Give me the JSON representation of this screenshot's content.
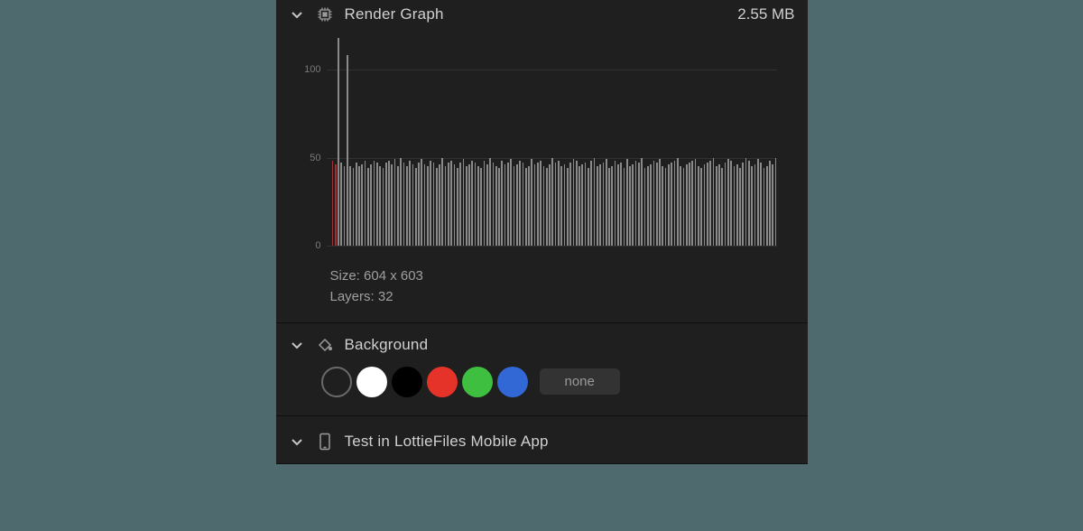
{
  "render_graph": {
    "title": "Render Graph",
    "file_size": "2.55 MB",
    "size_label": "Size: 604 x 603",
    "layers_label": "Layers: 32"
  },
  "background": {
    "title": "Background",
    "none_label": "none",
    "swatches": [
      "transparent",
      "#ffffff",
      "#000000",
      "#e6332a",
      "#3fbf3f",
      "#3268d6"
    ]
  },
  "test_section": {
    "title": "Test in LottieFiles Mobile App"
  },
  "chart_data": {
    "type": "bar",
    "title": "Render Graph",
    "xlabel": "",
    "ylabel": "",
    "ylim": [
      0,
      120
    ],
    "ticks": [
      0,
      50,
      100
    ],
    "values": [
      48,
      46,
      118,
      47,
      45,
      108,
      45,
      44,
      47,
      45,
      46,
      48,
      44,
      46,
      48,
      47,
      45,
      44,
      47,
      48,
      46,
      49,
      45,
      50,
      47,
      45,
      48,
      46,
      44,
      47,
      49,
      46,
      45,
      48,
      47,
      44,
      46,
      50,
      45,
      47,
      48,
      46,
      44,
      47,
      49,
      45,
      46,
      48,
      47,
      45,
      44,
      48,
      46,
      50,
      47,
      45,
      44,
      48,
      46,
      47,
      49,
      45,
      46,
      48,
      47,
      44,
      45,
      49,
      46,
      47,
      48,
      45,
      44,
      46,
      50,
      47,
      48,
      45,
      46,
      44,
      47,
      49,
      48,
      45,
      46,
      47,
      44,
      48,
      50,
      45,
      46,
      47,
      49,
      44,
      45,
      48,
      46,
      47,
      44,
      49,
      45,
      46,
      48,
      47,
      50,
      44,
      45,
      46,
      48,
      47,
      49,
      45,
      44,
      46,
      47,
      48,
      50,
      45,
      44,
      46,
      47,
      48,
      49,
      45,
      44,
      46,
      47,
      48,
      50,
      45,
      46,
      44,
      47,
      49,
      48,
      45,
      46,
      44,
      47,
      50,
      48,
      45,
      46,
      49,
      47,
      44,
      45,
      48,
      46,
      50
    ]
  }
}
